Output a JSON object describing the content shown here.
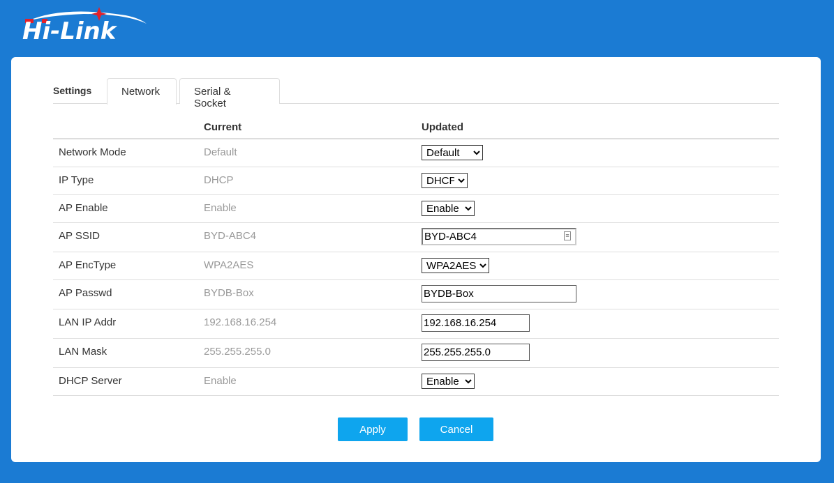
{
  "brand": {
    "logo_text": "Hi-Link",
    "logo_color": "#ffffff",
    "accent": "#e3202a"
  },
  "tabs": {
    "section_label": "Settings",
    "items": [
      {
        "label": "Network"
      },
      {
        "label": "Serial & Socket"
      }
    ]
  },
  "table": {
    "headers": {
      "current": "Current",
      "updated": "Updated"
    },
    "rows": [
      {
        "label": "Network Mode",
        "current": "Default",
        "type": "select",
        "value": "Default"
      },
      {
        "label": "IP Type",
        "current": "DHCP",
        "type": "select",
        "value": "DHCP"
      },
      {
        "label": "AP Enable",
        "current": "Enable",
        "type": "select",
        "value": "Enable"
      },
      {
        "label": "AP SSID",
        "current": "BYD-ABC4",
        "type": "ssid",
        "value": "BYD-ABC4"
      },
      {
        "label": "AP EncType",
        "current": "WPA2AES",
        "type": "select",
        "value": "WPA2AES"
      },
      {
        "label": "AP Passwd",
        "current": "BYDB-Box",
        "type": "text",
        "value": "BYDB-Box"
      },
      {
        "label": "LAN IP Addr",
        "current": "192.168.16.254",
        "type": "text",
        "value": "192.168.16.254"
      },
      {
        "label": "LAN Mask",
        "current": "255.255.255.0",
        "type": "text",
        "value": "255.255.255.0"
      },
      {
        "label": "DHCP Server",
        "current": "Enable",
        "type": "select",
        "value": "Enable"
      }
    ]
  },
  "buttons": {
    "apply": "Apply",
    "cancel": "Cancel"
  }
}
